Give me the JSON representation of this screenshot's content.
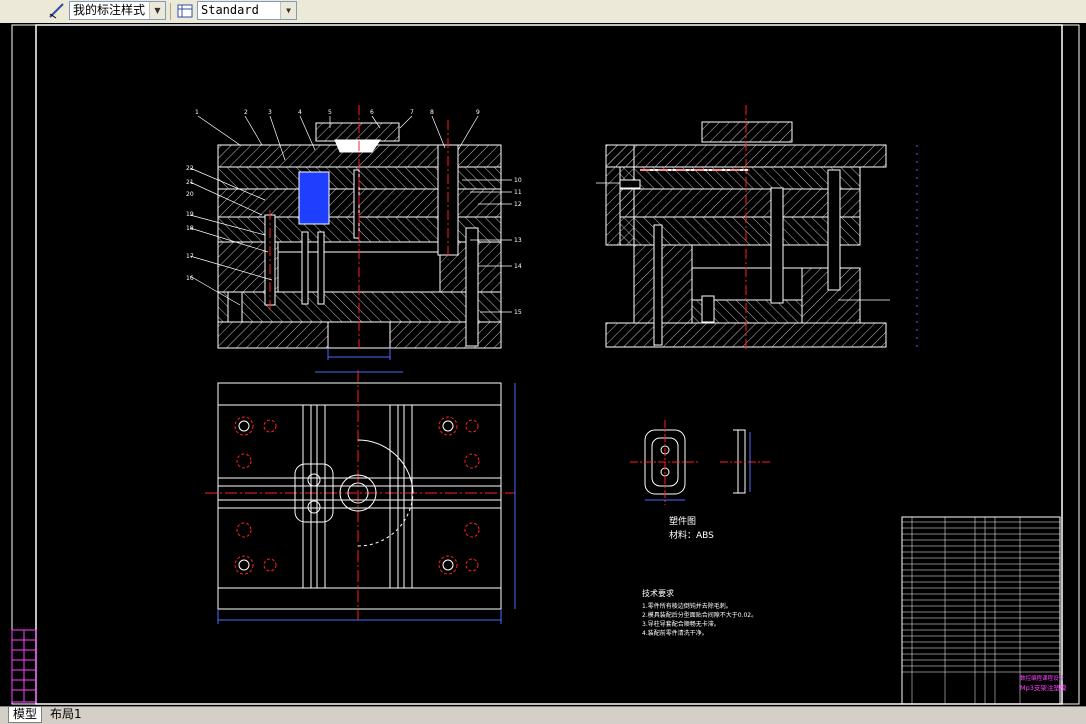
{
  "toolbar": {
    "dim_style_value": "我的标注样式",
    "table_style_value": "Standard"
  },
  "drawing": {
    "part_caption": "塑件图",
    "material_label": "材料：ABS",
    "tech_title": "技术要求",
    "tech_notes": [
      "1.零件所有棱边倒钝并去除毛刺。",
      "2.模具装配后分型面贴合间隙不大于0.02。",
      "3.导柱导套配合顺畅无卡滞。",
      "4.装配前零件清洗干净。"
    ],
    "title_block": {
      "title": "Mp3支架注塑模",
      "subtitle": "数控编程课程设计"
    }
  },
  "layout_tabs": [
    "模型",
    "布局1"
  ],
  "colors": {
    "canvas": "#000000",
    "line": "#ffffff",
    "hatch": "#c8c8c8",
    "center": "#ff2020",
    "dimension": "#4a6cff",
    "part": "#1f3fff",
    "titleblock": "#ff40ff",
    "yellow": "#ffff00"
  }
}
